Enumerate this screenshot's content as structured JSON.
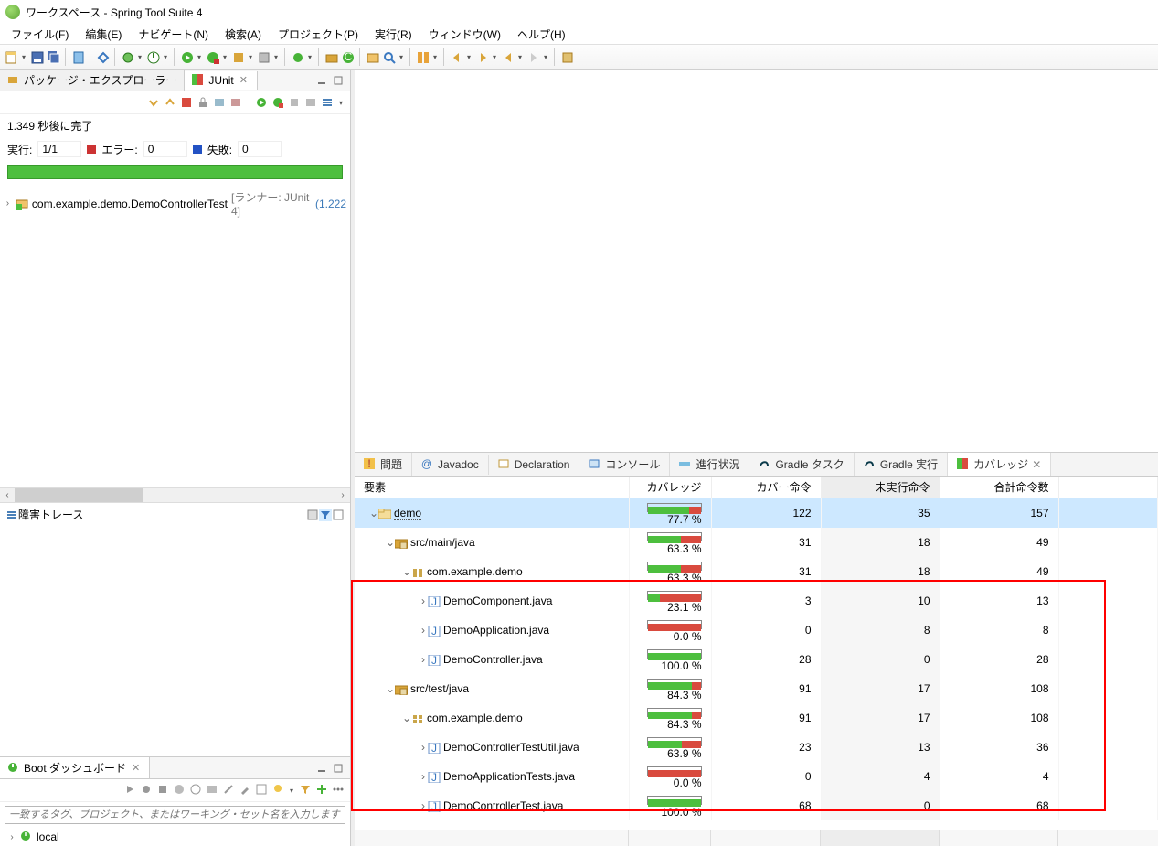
{
  "title": "ワークスペース - Spring Tool Suite 4",
  "menu": {
    "file": "ファイル(F)",
    "edit": "編集(E)",
    "navigate": "ナビゲート(N)",
    "search": "検索(A)",
    "project": "プロジェクト(P)",
    "run": "実行(R)",
    "window": "ウィンドウ(W)",
    "help": "ヘルプ(H)"
  },
  "left_tabs": {
    "pkg": "パッケージ・エクスプローラー",
    "junit": "JUnit"
  },
  "junit": {
    "finished": "1.349 秒後に完了",
    "runs_lbl": "実行:",
    "runs_val": "1/1",
    "errors_lbl": "エラー:",
    "errors_val": "0",
    "fail_lbl": "失敗:",
    "fail_val": "0",
    "test": "com.example.demo.DemoControllerTest",
    "runner": "[ランナー: JUnit 4]",
    "time": "(1.222"
  },
  "trace_lbl": "障害トレース",
  "boot": {
    "title": "Boot ダッシュボード",
    "filter_ph": "一致するタグ、プロジェクト、またはワーキング・セット名を入力します (* および ?",
    "local": "local"
  },
  "bottom_tabs": {
    "problems": "問題",
    "javadoc": "Javadoc",
    "decl": "Declaration",
    "console": "コンソール",
    "progress": "進行状況",
    "gtask": "Gradle タスク",
    "gexec": "Gradle 実行",
    "coverage": "カバレッジ"
  },
  "cov_headers": {
    "elem": "要素",
    "cov": "カバレッジ",
    "covered": "カバー命令",
    "missed": "未実行命令",
    "total": "合計命令数"
  },
  "coverage": [
    {
      "d": 0,
      "exp": "v",
      "ico": "proj",
      "name": "demo",
      "sel": true,
      "cov": 77.7,
      "covered": 122,
      "missed": 35,
      "total": 157
    },
    {
      "d": 1,
      "exp": "v",
      "ico": "src",
      "name": "src/main/java",
      "cov": 63.3,
      "covered": 31,
      "missed": 18,
      "total": 49
    },
    {
      "d": 2,
      "exp": "v",
      "ico": "pkg",
      "name": "com.example.demo",
      "cov": 63.3,
      "covered": 31,
      "missed": 18,
      "total": 49
    },
    {
      "d": 3,
      "exp": ">",
      "ico": "java",
      "name": "DemoComponent.java",
      "cov": 23.1,
      "covered": 3,
      "missed": 10,
      "total": 13
    },
    {
      "d": 3,
      "exp": ">",
      "ico": "java",
      "name": "DemoApplication.java",
      "cov": 0.0,
      "covered": 0,
      "missed": 8,
      "total": 8
    },
    {
      "d": 3,
      "exp": ">",
      "ico": "java",
      "name": "DemoController.java",
      "cov": 100.0,
      "covered": 28,
      "missed": 0,
      "total": 28
    },
    {
      "d": 1,
      "exp": "v",
      "ico": "src",
      "name": "src/test/java",
      "cov": 84.3,
      "covered": 91,
      "missed": 17,
      "total": 108
    },
    {
      "d": 2,
      "exp": "v",
      "ico": "pkg",
      "name": "com.example.demo",
      "cov": 84.3,
      "covered": 91,
      "missed": 17,
      "total": 108
    },
    {
      "d": 3,
      "exp": ">",
      "ico": "java",
      "name": "DemoControllerTestUtil.java",
      "cov": 63.9,
      "covered": 23,
      "missed": 13,
      "total": 36
    },
    {
      "d": 3,
      "exp": ">",
      "ico": "java",
      "name": "DemoApplicationTests.java",
      "cov": 0.0,
      "covered": 0,
      "missed": 4,
      "total": 4
    },
    {
      "d": 3,
      "exp": ">",
      "ico": "java",
      "name": "DemoControllerTest.java",
      "cov": 100.0,
      "covered": 68,
      "missed": 0,
      "total": 68
    }
  ]
}
